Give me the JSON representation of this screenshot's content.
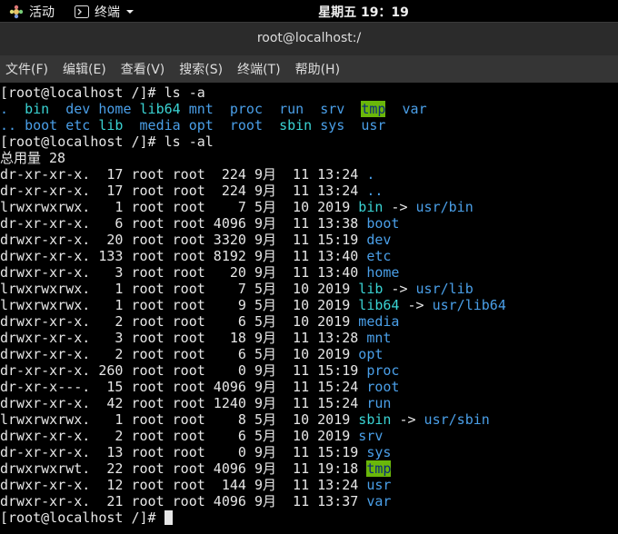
{
  "topbar": {
    "activities_label": "活动",
    "terminal_label": "终端",
    "clock": "星期五 19：19"
  },
  "window": {
    "title": "root@localhost:/"
  },
  "menu": [
    "文件(F)",
    "编辑(E)",
    "查看(V)",
    "搜索(S)",
    "终端(T)",
    "帮助(H)"
  ],
  "colors": {
    "dir": "#4a9fe8",
    "link": "#3ad4d4",
    "sticky_bg": "#6ab70a",
    "sticky_fg": "#0a2c7a"
  },
  "terminal": {
    "prompt": "[root@localhost /]#",
    "cmd1": " ls -a",
    "cmd2": " ls -al",
    "ls_a_row1": [
      ".",
      "bin",
      "dev",
      "home",
      "lib64",
      "mnt",
      "proc",
      "run",
      "srv",
      "tmp",
      "var"
    ],
    "ls_a_row2": [
      "..",
      "boot",
      "etc",
      "lib",
      "media",
      "opt",
      "root",
      "sbin",
      "sys",
      "usr"
    ],
    "total": "总用量 28",
    "entries": [
      {
        "meta": "dr-xr-xr-x.  17 root root  224 9月  11 13:24 ",
        "name": ".",
        "type": "dir"
      },
      {
        "meta": "dr-xr-xr-x.  17 root root  224 9月  11 13:24 ",
        "name": "..",
        "type": "dir"
      },
      {
        "meta": "lrwxrwxrwx.   1 root root    7 5月  10 2019 ",
        "name": "bin",
        "type": "link",
        "target": "usr/bin"
      },
      {
        "meta": "dr-xr-xr-x.   6 root root 4096 9月  11 13:38 ",
        "name": "boot",
        "type": "dir"
      },
      {
        "meta": "drwxr-xr-x.  20 root root 3320 9月  11 15:19 ",
        "name": "dev",
        "type": "dir"
      },
      {
        "meta": "drwxr-xr-x. 133 root root 8192 9月  11 13:40 ",
        "name": "etc",
        "type": "dir"
      },
      {
        "meta": "drwxr-xr-x.   3 root root   20 9月  11 13:40 ",
        "name": "home",
        "type": "dir"
      },
      {
        "meta": "lrwxrwxrwx.   1 root root    7 5月  10 2019 ",
        "name": "lib",
        "type": "link",
        "target": "usr/lib"
      },
      {
        "meta": "lrwxrwxrwx.   1 root root    9 5月  10 2019 ",
        "name": "lib64",
        "type": "link",
        "target": "usr/lib64"
      },
      {
        "meta": "drwxr-xr-x.   2 root root    6 5月  10 2019 ",
        "name": "media",
        "type": "dir"
      },
      {
        "meta": "drwxr-xr-x.   3 root root   18 9月  11 13:28 ",
        "name": "mnt",
        "type": "dir"
      },
      {
        "meta": "drwxr-xr-x.   2 root root    6 5月  10 2019 ",
        "name": "opt",
        "type": "dir"
      },
      {
        "meta": "dr-xr-xr-x. 260 root root    0 9月  11 15:19 ",
        "name": "proc",
        "type": "dir"
      },
      {
        "meta": "dr-xr-x---.  15 root root 4096 9月  11 15:24 ",
        "name": "root",
        "type": "dir"
      },
      {
        "meta": "drwxr-xr-x.  42 root root 1240 9月  11 15:24 ",
        "name": "run",
        "type": "dir"
      },
      {
        "meta": "lrwxrwxrwx.   1 root root    8 5月  10 2019 ",
        "name": "sbin",
        "type": "link",
        "target": "usr/sbin"
      },
      {
        "meta": "drwxr-xr-x.   2 root root    6 5月  10 2019 ",
        "name": "srv",
        "type": "dir"
      },
      {
        "meta": "dr-xr-xr-x.  13 root root    0 9月  11 15:19 ",
        "name": "sys",
        "type": "dir"
      },
      {
        "meta": "drwxrwxrwt.  22 root root 4096 9月  11 19:18 ",
        "name": "tmp",
        "type": "sticky"
      },
      {
        "meta": "drwxr-xr-x.  12 root root  144 9月  11 13:24 ",
        "name": "usr",
        "type": "dir"
      },
      {
        "meta": "drwxr-xr-x.  21 root root 4096 9月  11 13:37 ",
        "name": "var",
        "type": "dir"
      }
    ],
    "arrow": " -> "
  }
}
